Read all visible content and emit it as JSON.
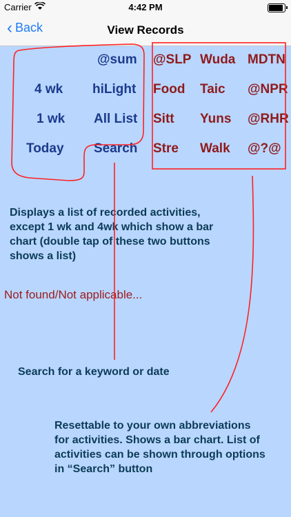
{
  "status": {
    "carrier": "Carrier",
    "time": "4:42 PM"
  },
  "nav": {
    "back_label": "Back",
    "title": "View Records"
  },
  "left_buttons": {
    "sum": "@sum",
    "four_wk": "4 wk",
    "hilight": "hiLight",
    "one_wk": "1 wk",
    "all_list": "All List",
    "today": "Today",
    "search": "Search"
  },
  "grid_buttons": [
    [
      "@SLP",
      "Wuda",
      "MDTN"
    ],
    [
      "Food",
      "Taic",
      "@NPR"
    ],
    [
      "Sitt",
      "Yuns",
      "@RHR"
    ],
    [
      "Stre",
      "Walk",
      "@?@"
    ]
  ],
  "notes": {
    "list_description": "Displays a list of recorded activities, except 1 wk and 4wk which show a bar chart (double tap of these two buttons shows a list)",
    "not_found": "Not found/Not applicable...",
    "search_help": "Search for a keyword or date",
    "reset_help": "Resettable to your own abbreviations for activities. Shows a bar chart. List of activities can be shown through options in “Search” button"
  },
  "colors": {
    "background": "#b9d6ff",
    "annotation": "#ff2020",
    "navy": "#1c3a8c",
    "maroon": "#8e1b1b"
  }
}
